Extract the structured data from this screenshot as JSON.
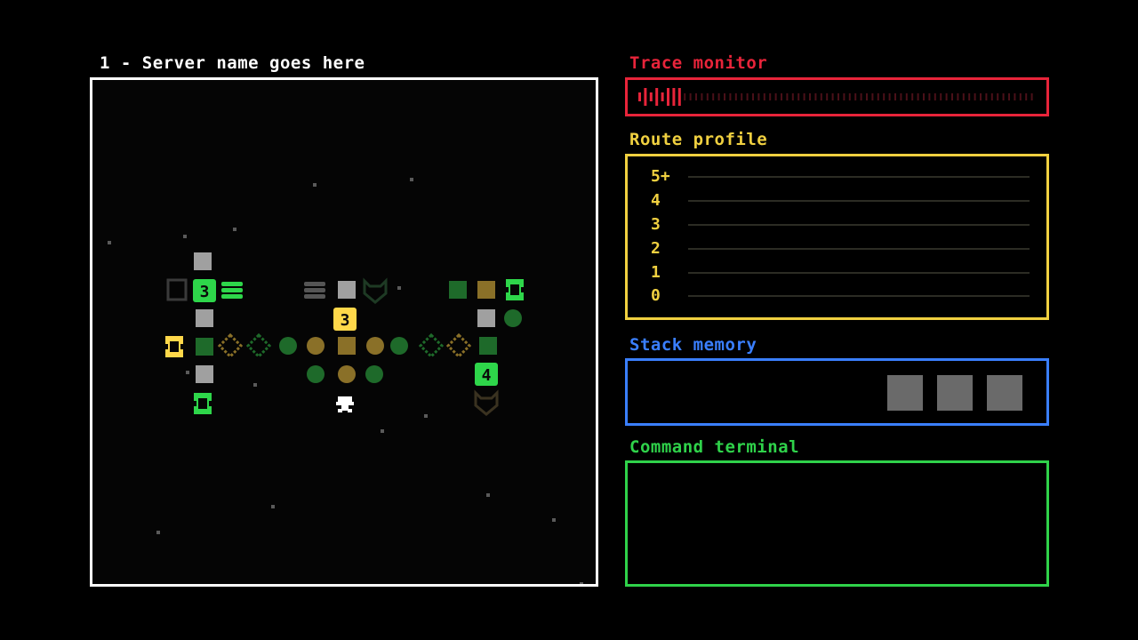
{
  "map": {
    "title": "1 - Server name goes here",
    "colors": {
      "border": "#ffffff",
      "bright_green": "#2ed64a",
      "dark_green": "#1e6a2a",
      "gold": "#8a7028",
      "yellow": "#ffd84a",
      "grey": "#a0a0a0",
      "dark_grey": "#555555",
      "star": "#5a5a5a",
      "player": "#ffffff"
    },
    "badges": [
      {
        "id": "3",
        "label": "3",
        "kind": "green"
      },
      {
        "id": "3b",
        "label": "3",
        "kind": "yellow"
      },
      {
        "id": "4",
        "label": "4",
        "kind": "green"
      }
    ],
    "icons": [
      "firewall-icon",
      "database-icon",
      "door-icon",
      "wolf-icon",
      "player-icon",
      "node-icon",
      "link-icon"
    ]
  },
  "trace": {
    "title": "Trace monitor",
    "color": "#e8243a",
    "level": 0.12
  },
  "route": {
    "title": "Route profile",
    "color": "#f0d040",
    "rows": [
      "5+",
      "4",
      "3",
      "2",
      "1",
      "0"
    ],
    "values": [
      0,
      0,
      0,
      0,
      0,
      0
    ]
  },
  "stack": {
    "title": "Stack memory",
    "color": "#3a7fff",
    "slots": 3
  },
  "terminal": {
    "title": "Command terminal",
    "color": "#2fd24a",
    "output": ""
  }
}
